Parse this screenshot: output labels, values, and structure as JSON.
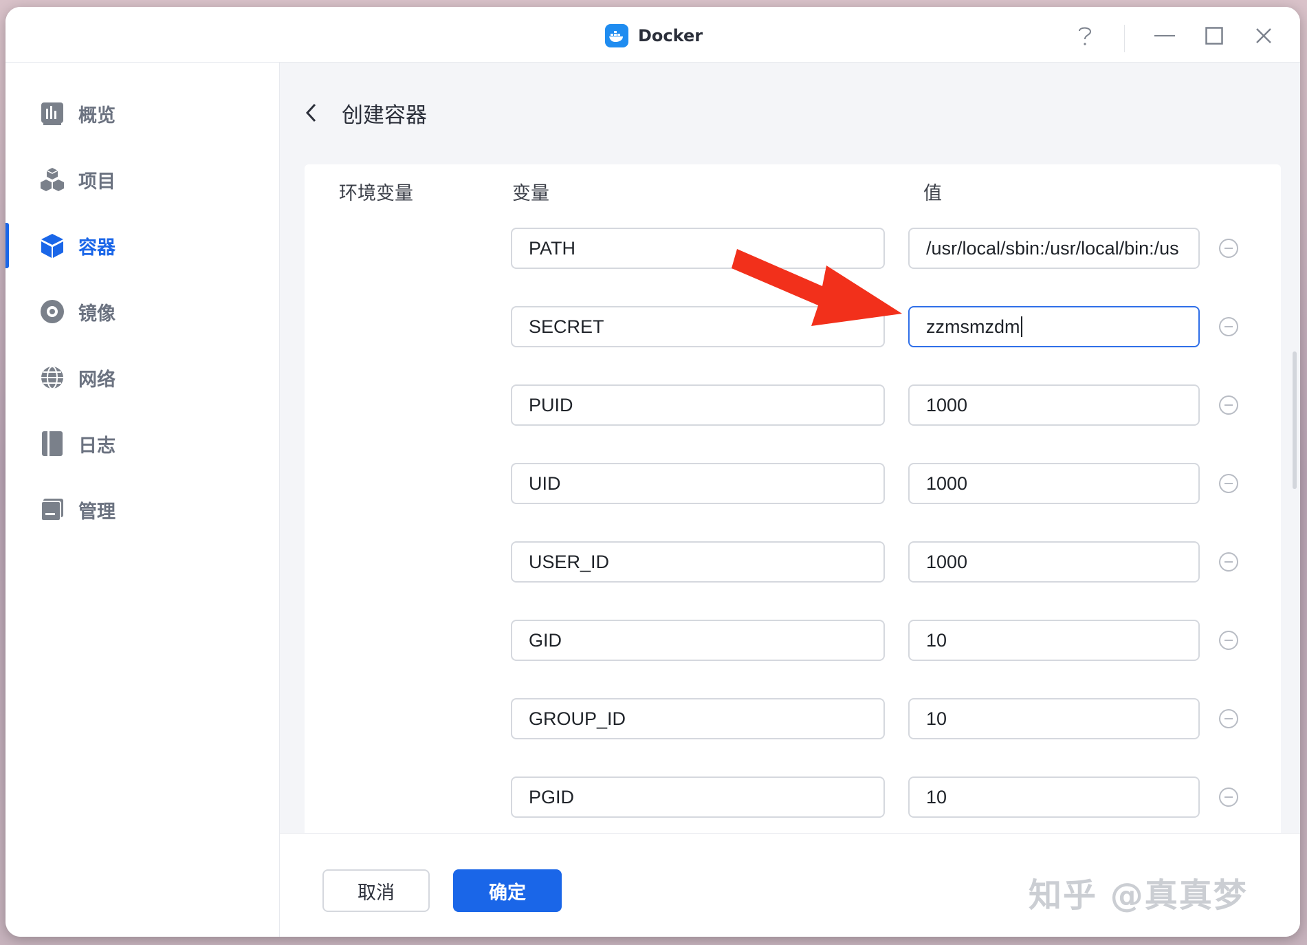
{
  "window": {
    "title": "Docker"
  },
  "sidebar": {
    "items": [
      {
        "label": "概览",
        "icon": "bar-chart-icon",
        "active": false
      },
      {
        "label": "项目",
        "icon": "cubes-icon",
        "active": false
      },
      {
        "label": "容器",
        "icon": "container-icon",
        "active": true
      },
      {
        "label": "镜像",
        "icon": "disc-icon",
        "active": false
      },
      {
        "label": "网络",
        "icon": "globe-icon",
        "active": false
      },
      {
        "label": "日志",
        "icon": "log-book-icon",
        "active": false
      },
      {
        "label": "管理",
        "icon": "manage-icon",
        "active": false
      }
    ]
  },
  "page": {
    "title": "创建容器"
  },
  "env": {
    "section_label": "环境变量",
    "var_header": "变量",
    "value_header": "值",
    "rows": [
      {
        "name": "PATH",
        "value": "/usr/local/sbin:/usr/local/bin:/us"
      },
      {
        "name": "SECRET",
        "value": "zzmsmzdm",
        "focused": true
      },
      {
        "name": "PUID",
        "value": "1000"
      },
      {
        "name": "UID",
        "value": "1000"
      },
      {
        "name": "USER_ID",
        "value": "1000"
      },
      {
        "name": "GID",
        "value": "10"
      },
      {
        "name": "GROUP_ID",
        "value": "10"
      },
      {
        "name": "PGID",
        "value": "10"
      }
    ]
  },
  "footer": {
    "cancel_label": "取消",
    "ok_label": "确定"
  },
  "watermark": "知乎 @真真梦",
  "colors": {
    "accent": "#1a66e8",
    "focus_border": "#2f6fe8",
    "annotation_arrow": "#f2301b"
  }
}
